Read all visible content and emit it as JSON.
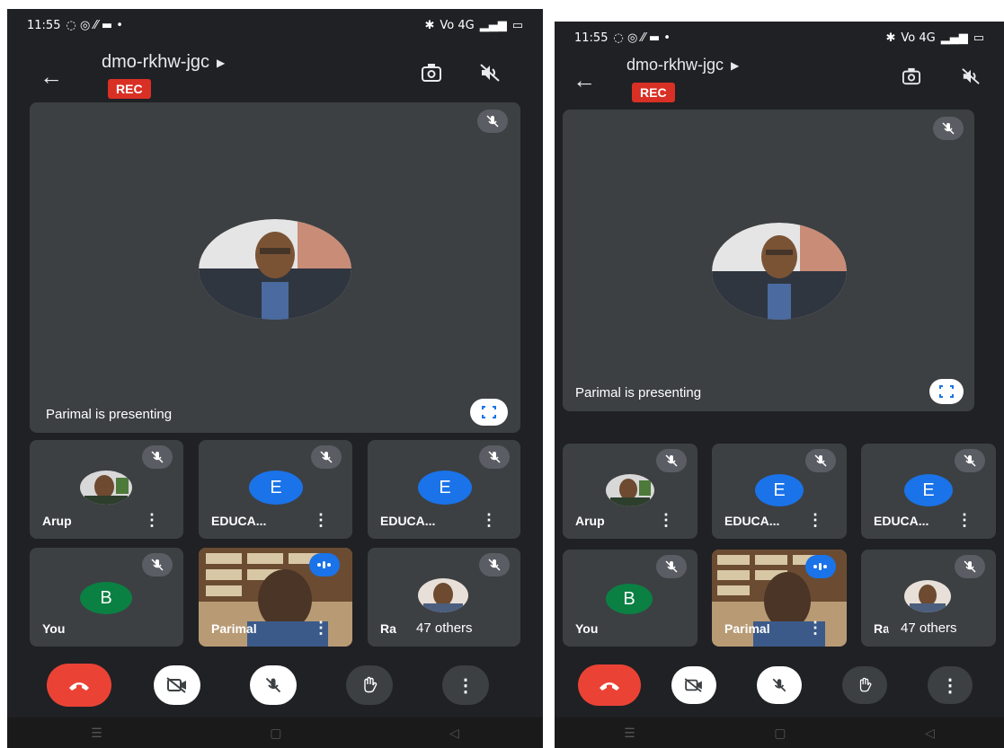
{
  "status": {
    "time": "11:55",
    "net": "Vo 4G"
  },
  "meeting": {
    "code": "dmo-rkhw-jgc",
    "rec_label": "REC"
  },
  "presenter": {
    "text": "Parimal is presenting"
  },
  "tiles": [
    {
      "name": "Arup",
      "type": "photo"
    },
    {
      "name": "EDUCA...",
      "type": "letter",
      "letter": "E",
      "color": "#1a73e8"
    },
    {
      "name": "EDUCA...",
      "type": "letter",
      "letter": "E",
      "color": "#1a73e8"
    },
    {
      "name": "You",
      "type": "letter",
      "letter": "B",
      "color": "#0b8043"
    },
    {
      "name": "Parimal",
      "type": "video"
    },
    {
      "name": "Ra",
      "type": "photo",
      "others": "47 others"
    }
  ],
  "colors": {
    "bg": "#202124",
    "tile": "#3c4043",
    "hangup": "#ea4335",
    "rec": "#d93025"
  },
  "icons": [
    "back-arrow-icon",
    "switch-camera-icon",
    "speaker-off-icon",
    "mic-off-icon",
    "fullscreen-icon",
    "more-vert-icon",
    "end-call-icon",
    "camera-off-icon",
    "raise-hand-icon"
  ]
}
